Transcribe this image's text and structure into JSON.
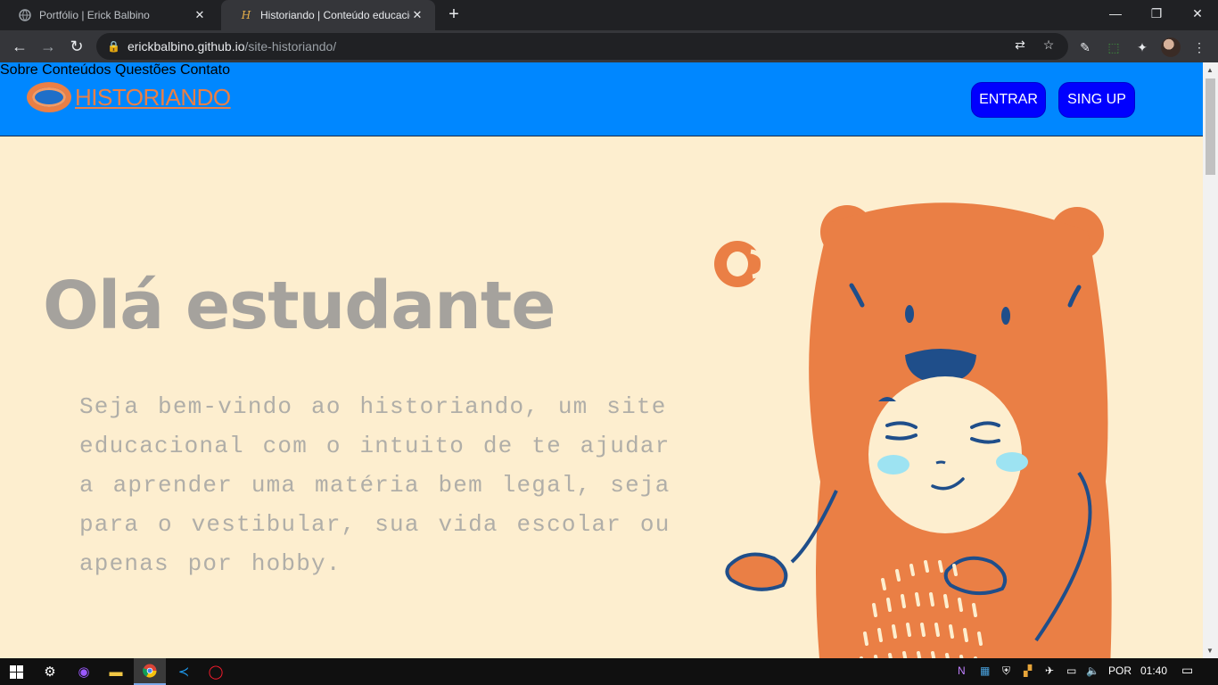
{
  "browser": {
    "tabs": [
      {
        "title": "Portfólio | Erick Balbino",
        "active": false
      },
      {
        "title": "Historiando | Conteúdo educacio",
        "active": true
      }
    ],
    "url_host": "erickbalbino.github.io",
    "url_path": "/site-historiando/"
  },
  "site": {
    "logo_text": "HISTORIANDO",
    "nav": [
      "Sobre",
      "Conteúdos",
      "Questões",
      "Contato"
    ],
    "login_label": "ENTRAR",
    "signup_label": "SING UP",
    "hero_title": "Olá estudante",
    "hero_text": "Seja bem-vindo ao historiando, um site educacional com o intuito de te ajudar a aprender uma matéria bem legal, seja para o vestibular, sua vida escolar ou apenas por hobby."
  },
  "colors": {
    "header_blue": "#0087ff",
    "button_blue": "#0000ff",
    "page_bg": "#fdeecf",
    "accent_orange": "#ea7f45"
  },
  "taskbar": {
    "language": "POR",
    "time": "01:40"
  }
}
